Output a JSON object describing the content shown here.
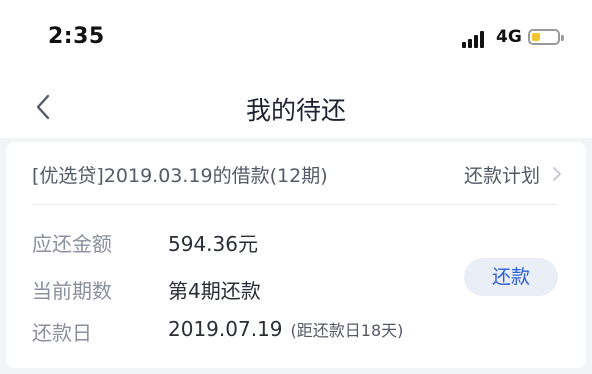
{
  "status_bar": {
    "time": "2:35",
    "network": "4G",
    "battery_level": 0.35,
    "battery_color": "#f2c42d"
  },
  "nav": {
    "title": "我的待还",
    "back_icon": "chevron-left-icon"
  },
  "loan": {
    "title": "[优选贷]2019.03.19的借款(12期)",
    "plan_link": "还款计划",
    "rows": [
      {
        "label": "应还金额",
        "value": "594.36元"
      },
      {
        "label": "当前期数",
        "value": "第4期还款"
      },
      {
        "label": "还款日",
        "value": "2019.07.19",
        "note": "(距还款日18天)"
      }
    ],
    "repay_button": "还款"
  },
  "colors": {
    "accent": "#2e5fd6",
    "button_bg": "#e9eef7",
    "page_bg": "#f3f4f6"
  }
}
